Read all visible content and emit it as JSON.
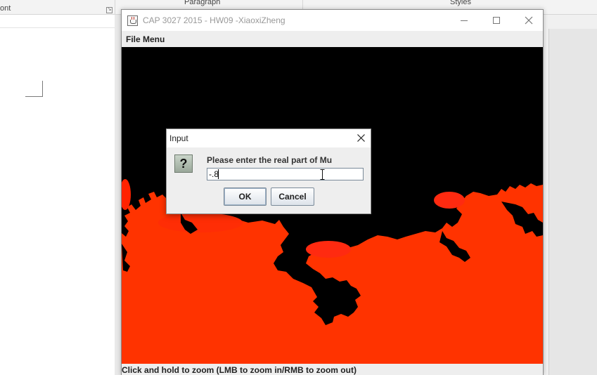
{
  "background_app": {
    "ribbon_groups": [
      "ont",
      "Paragraph",
      "Styles"
    ]
  },
  "window": {
    "title": "CAP 3027 2015 - HW09 -XiaoxiZheng",
    "icon": "java-cup-icon",
    "controls": {
      "minimize": "minimize-icon",
      "maximize": "maximize-icon",
      "close": "close-icon"
    }
  },
  "menubar": {
    "file_menu": "File Menu"
  },
  "canvas": {
    "description_colors": {
      "set": "#000000",
      "escape": "#ff3300"
    }
  },
  "status_bar": {
    "text": "Click and hold to zoom (LMB to zoom in/RMB to zoom out)"
  },
  "dialog": {
    "title": "Input",
    "icon": "question-icon",
    "icon_glyph": "?",
    "prompt": "Please enter the real part of Mu",
    "input_value": "-.8",
    "ok_label": "OK",
    "cancel_label": "Cancel"
  },
  "colors": {
    "fractal_red": "#ff3300",
    "fractal_black": "#000000",
    "window_bg": "#eeeeee"
  }
}
